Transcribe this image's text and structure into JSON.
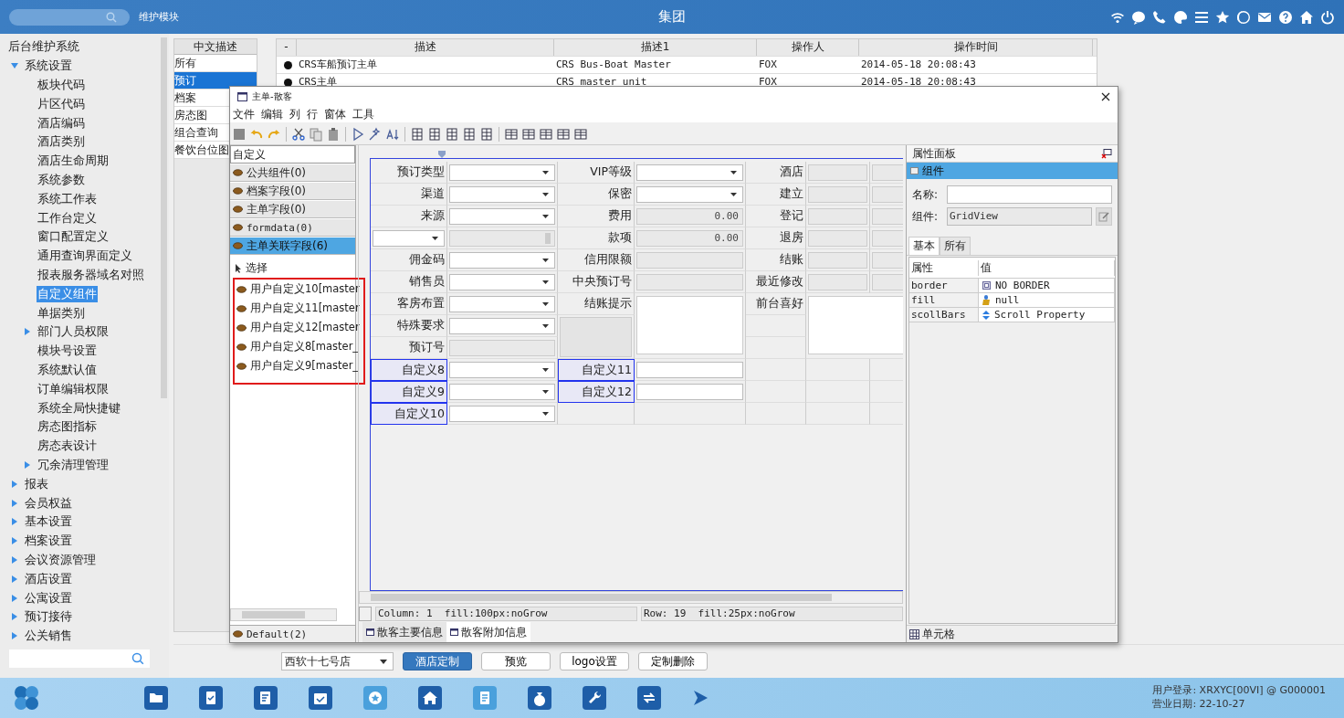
{
  "topbar": {
    "module": "维护模块",
    "title": "集团"
  },
  "sidebar": {
    "root": "后台维护系统",
    "items": [
      {
        "label": "系统设置",
        "expanded": true,
        "selected": false,
        "children": [
          {
            "label": "板块代码",
            "selected": false
          },
          {
            "label": "片区代码",
            "selected": false
          },
          {
            "label": "酒店编码",
            "selected": false
          },
          {
            "label": "酒店类别",
            "selected": false
          },
          {
            "label": "酒店生命周期",
            "selected": false
          },
          {
            "label": "系统参数",
            "selected": false
          },
          {
            "label": "系统工作表",
            "selected": false
          },
          {
            "label": "工作台定义",
            "selected": false
          },
          {
            "label": "窗口配置定义",
            "selected": false
          },
          {
            "label": "通用查询界面定义",
            "selected": false
          },
          {
            "label": "报表服务器域名对照",
            "selected": false
          },
          {
            "label": "自定义组件",
            "selected": true
          },
          {
            "label": "单据类别",
            "selected": false
          },
          {
            "label": "部门人员权限",
            "expanded": false,
            "selected": false
          },
          {
            "label": "模块号设置",
            "selected": false
          },
          {
            "label": "系统默认值",
            "selected": false
          },
          {
            "label": "订单编辑权限",
            "selected": false
          },
          {
            "label": "系统全局快捷键",
            "selected": false
          },
          {
            "label": "房态图指标",
            "selected": false
          },
          {
            "label": "房态表设计",
            "selected": false
          },
          {
            "label": "冗余清理管理",
            "expanded": false,
            "selected": false
          }
        ]
      },
      {
        "label": "报表",
        "expanded": false,
        "selected": false
      },
      {
        "label": "会员权益",
        "expanded": false,
        "selected": false
      },
      {
        "label": "基本设置",
        "expanded": false,
        "selected": false
      },
      {
        "label": "档案设置",
        "expanded": false,
        "selected": false
      },
      {
        "label": "会议资源管理",
        "expanded": false,
        "selected": false
      },
      {
        "label": "酒店设置",
        "expanded": false,
        "selected": false
      },
      {
        "label": "公寓设置",
        "expanded": false,
        "selected": false
      },
      {
        "label": "预订接待",
        "expanded": false,
        "selected": false
      },
      {
        "label": "公关销售",
        "expanded": false,
        "selected": false
      }
    ]
  },
  "categories": {
    "header": "中文描述",
    "items": [
      {
        "label": "所有",
        "selected": false
      },
      {
        "label": "预订",
        "selected": true
      },
      {
        "label": "档案",
        "selected": false
      },
      {
        "label": "房态图",
        "selected": false
      },
      {
        "label": "组合查询",
        "selected": false
      },
      {
        "label": "餐饮台位图",
        "selected": false
      }
    ]
  },
  "table": {
    "columns": [
      "-",
      "描述",
      "描述1",
      "操作人",
      "操作时间"
    ],
    "rows": [
      {
        "cells": [
          "CRS车船预订主单",
          "CRS Bus-Boat Master",
          "FOX",
          "2014-05-18 20:08:43"
        ]
      },
      {
        "cells": [
          "CRS主单",
          "CRS master unit",
          "FOX",
          "2014-05-18 20:08:43"
        ]
      }
    ]
  },
  "actions": {
    "store": "西软十七号店",
    "buttons": [
      {
        "label": "酒店定制",
        "selected": true
      },
      {
        "label": "预览",
        "selected": false
      },
      {
        "label": "logo设置",
        "selected": false
      },
      {
        "label": "定制删除",
        "selected": false
      }
    ]
  },
  "dialog": {
    "title": "主单-散客",
    "menu": [
      "文件",
      "编辑",
      "列",
      "行",
      "窗体",
      "工具"
    ],
    "palette": {
      "header": "自定义",
      "groups": [
        {
          "label": "公共组件(0)",
          "selected": false
        },
        {
          "label": "档案字段(0)",
          "selected": false
        },
        {
          "label": "主单字段(0)",
          "selected": false
        },
        {
          "label": "formdata(0)",
          "selected": false
        },
        {
          "label": "主单关联字段(6)",
          "selected": true
        }
      ],
      "tool": "选择",
      "fields": [
        "用户自定义10[master",
        "用户自定义11[master",
        "用户自定义12[master",
        "用户自定义8[master_",
        "用户自定义9[master_"
      ],
      "footer": "Default(2)"
    },
    "form": {
      "rows": [
        {
          "cells": [
            {
              "kind": "label",
              "text": "预订类型",
              "custom": false
            },
            {
              "kind": "select"
            },
            {
              "kind": "label",
              "text": "VIP等级",
              "custom": false
            },
            {
              "kind": "select"
            },
            {
              "kind": "label",
              "text": "酒店",
              "custom": false
            },
            {
              "kind": "readonly"
            },
            {
              "kind": "readonly"
            }
          ]
        },
        {
          "cells": [
            {
              "kind": "label",
              "text": "渠道",
              "custom": false
            },
            {
              "kind": "select"
            },
            {
              "kind": "label",
              "text": "保密",
              "custom": false
            },
            {
              "kind": "select"
            },
            {
              "kind": "label",
              "text": "建立",
              "custom": false
            },
            {
              "kind": "readonly"
            },
            {
              "kind": "readonly"
            }
          ]
        },
        {
          "cells": [
            {
              "kind": "label",
              "text": "来源",
              "custom": false
            },
            {
              "kind": "select"
            },
            {
              "kind": "label",
              "text": "费用",
              "custom": false
            },
            {
              "kind": "readonly",
              "value": "0.00"
            },
            {
              "kind": "label",
              "text": "登记",
              "custom": false
            },
            {
              "kind": "readonly"
            },
            {
              "kind": "readonly"
            }
          ]
        },
        {
          "cells": [
            {
              "kind": "select"
            },
            {
              "kind": "scrollbox"
            },
            {
              "kind": "label",
              "text": "款项",
              "custom": false
            },
            {
              "kind": "readonly",
              "value": "0.00"
            },
            {
              "kind": "label",
              "text": "退房",
              "custom": false
            },
            {
              "kind": "readonly"
            },
            {
              "kind": "readonly"
            }
          ]
        },
        {
          "cells": [
            {
              "kind": "label",
              "text": "佣金码",
              "custom": false
            },
            {
              "kind": "select"
            },
            {
              "kind": "label",
              "text": "信用限额",
              "custom": false
            },
            {
              "kind": "readonly"
            },
            {
              "kind": "label",
              "text": "结账",
              "custom": false
            },
            {
              "kind": "readonly"
            },
            {
              "kind": "readonly"
            }
          ]
        },
        {
          "cells": [
            {
              "kind": "label",
              "text": "销售员",
              "custom": false
            },
            {
              "kind": "select"
            },
            {
              "kind": "label",
              "text": "中央预订号",
              "custom": false
            },
            {
              "kind": "readonly"
            },
            {
              "kind": "label",
              "text": "最近修改",
              "custom": false
            },
            {
              "kind": "readonly"
            },
            {
              "kind": "readonly"
            }
          ]
        },
        {
          "cells": [
            {
              "kind": "label",
              "text": "客房布置",
              "custom": false
            },
            {
              "kind": "select"
            },
            {
              "kind": "label",
              "text": "结账提示",
              "custom": false
            },
            {
              "kind": "textarea"
            },
            {
              "kind": "label",
              "text": "前台喜好",
              "custom": false
            },
            {
              "kind": "widetextarea"
            }
          ]
        },
        {
          "cells": [
            {
              "kind": "label",
              "text": "特殊要求",
              "custom": false
            },
            {
              "kind": "select"
            },
            {
              "kind": "panel"
            },
            {
              "kind": "empty"
            }
          ]
        },
        {
          "cells": [
            {
              "kind": "label",
              "text": "预订号",
              "custom": false
            },
            {
              "kind": "readonly"
            },
            {
              "kind": "empty"
            }
          ]
        },
        {
          "cells": [
            {
              "kind": "label",
              "text": "自定义8",
              "custom": true
            },
            {
              "kind": "select"
            },
            {
              "kind": "label",
              "text": "自定义11",
              "custom": true
            },
            {
              "kind": "input"
            },
            {
              "kind": "empty"
            },
            {
              "kind": "empty"
            },
            {
              "kind": "empty"
            }
          ]
        },
        {
          "cells": [
            {
              "kind": "label",
              "text": "自定义9",
              "custom": true
            },
            {
              "kind": "select"
            },
            {
              "kind": "label",
              "text": "自定义12",
              "custom": true
            },
            {
              "kind": "input"
            },
            {
              "kind": "empty"
            },
            {
              "kind": "empty"
            },
            {
              "kind": "empty"
            }
          ]
        },
        {
          "cells": [
            {
              "kind": "label",
              "text": "自定义10",
              "custom": true
            },
            {
              "kind": "select"
            },
            {
              "kind": "empty"
            },
            {
              "kind": "empty"
            },
            {
              "kind": "empty"
            },
            {
              "kind": "empty"
            },
            {
              "kind": "empty"
            }
          ]
        }
      ]
    },
    "status": [
      "Column: 1  fill:100px:noGrow",
      "Row: 19  fill:25px:noGrow"
    ],
    "tabs": [
      {
        "label": "散客主要信息",
        "selected": false
      },
      {
        "label": "散客附加信息",
        "selected": true
      }
    ],
    "properties": {
      "header": "属性面板",
      "section": "组件",
      "name_label": "名称:",
      "component_label": "组件:",
      "component_value": "GridView",
      "tabs": [
        {
          "label": "基本",
          "selected": true
        },
        {
          "label": "所有",
          "selected": false
        }
      ],
      "columns": [
        "属性",
        "值"
      ],
      "rows": [
        {
          "kind": "border",
          "name": "border",
          "value": "NO BORDER"
        },
        {
          "kind": "fill",
          "name": "fill",
          "value": "null"
        },
        {
          "kind": "scroll",
          "name": "scollBars",
          "value": "Scroll Property"
        }
      ],
      "footer": "单元格"
    }
  },
  "taskbar": {
    "info": [
      "用户登录: XRXYC[00VI] @ G000001",
      "营业日期: 22-10-27"
    ]
  }
}
